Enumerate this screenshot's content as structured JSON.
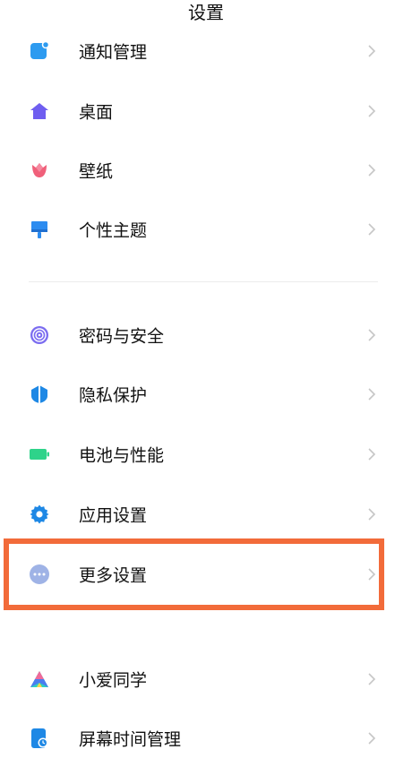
{
  "header": {
    "title": "设置"
  },
  "group1": {
    "items": [
      {
        "label": "通知管理",
        "icon": "notification-icon"
      },
      {
        "label": "桌面",
        "icon": "home-icon"
      },
      {
        "label": "壁纸",
        "icon": "tulip-icon"
      },
      {
        "label": "个性主题",
        "icon": "brush-icon"
      }
    ]
  },
  "group2": {
    "items": [
      {
        "label": "密码与安全",
        "icon": "fingerprint-icon"
      },
      {
        "label": "隐私保护",
        "icon": "shield-icon"
      },
      {
        "label": "电池与性能",
        "icon": "battery-icon"
      },
      {
        "label": "应用设置",
        "icon": "gear-icon"
      },
      {
        "label": "更多设置",
        "icon": "more-icon"
      }
    ]
  },
  "group3": {
    "items": [
      {
        "label": "小爱同学",
        "icon": "xiaoai-icon"
      },
      {
        "label": "屏幕时间管理",
        "icon": "screen-time-icon"
      }
    ]
  },
  "colors": {
    "highlight": "#f26b3a",
    "chevron": "#c6c6c6"
  }
}
